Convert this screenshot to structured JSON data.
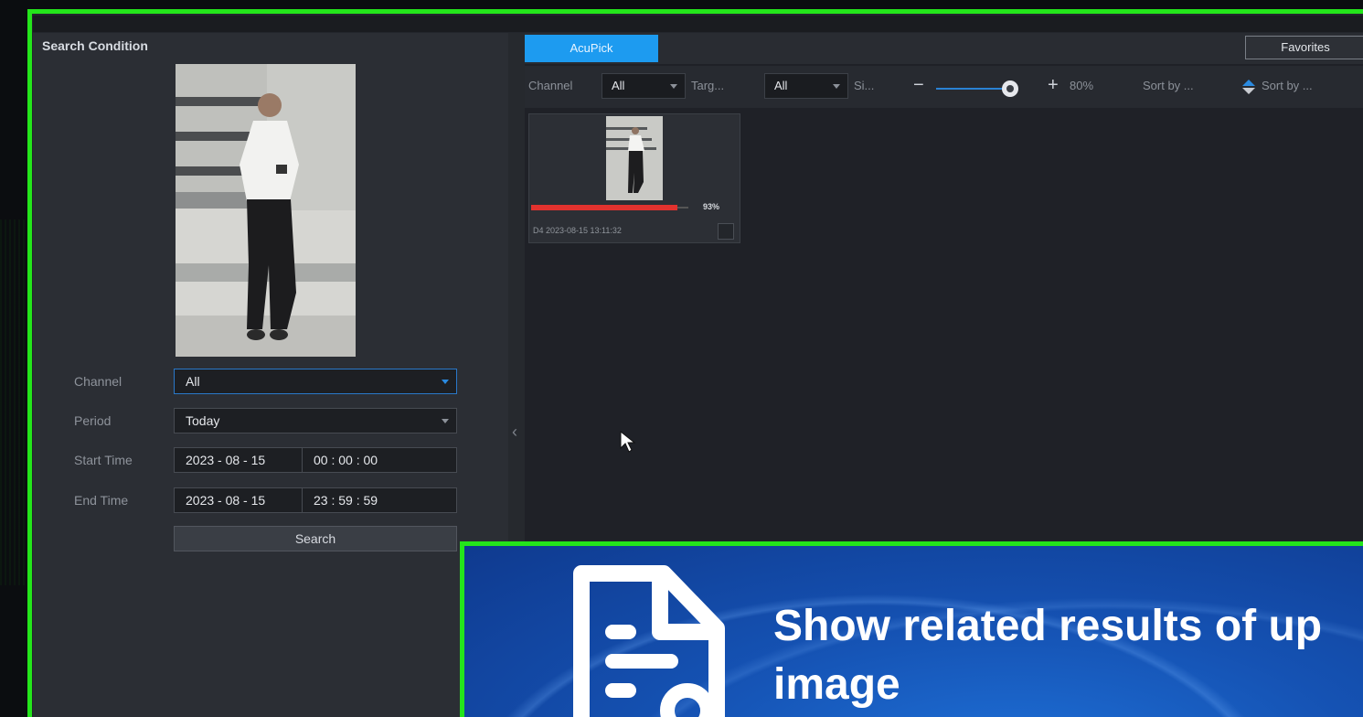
{
  "left_panel": {
    "title": "Search Condition",
    "form": {
      "channel": {
        "label": "Channel",
        "value": "All"
      },
      "period": {
        "label": "Period",
        "value": "Today"
      },
      "start_time": {
        "label": "Start Time",
        "date": "2023 - 08 - 15",
        "time": "00 : 00 : 00"
      },
      "end_time": {
        "label": "End Time",
        "date": "2023 - 08 - 15",
        "time": "23 : 59 : 59"
      }
    },
    "search_label": "Search"
  },
  "right_panel": {
    "tab": "AcuPick",
    "favorites_label": "Favorites",
    "filter": {
      "channel_label": "Channel",
      "channel_value": "All",
      "target_label": "Targ...",
      "target_value": "All",
      "similarity_label": "Si...",
      "zoom_value": "80%",
      "sort1": "Sort by ...",
      "sort2": "Sort by ..."
    },
    "results": [
      {
        "similarity_text": "93%",
        "similarity": 0.93,
        "timestamp": "D4 2023-08-15 13:11:32"
      }
    ]
  },
  "overlay": {
    "text": "Show related results of up\nimage"
  },
  "colors": {
    "frame": "#24e51b",
    "accent": "#1d9bf0",
    "similarity_bar": "#e2322e",
    "overlay_bg": "#1552b3"
  },
  "icons": [
    "chevron-left-icon",
    "chevron-down-icon",
    "zoom-minus-icon",
    "zoom-plus-icon",
    "sort-icon",
    "mouse-cursor-icon",
    "document-search-icon"
  ]
}
